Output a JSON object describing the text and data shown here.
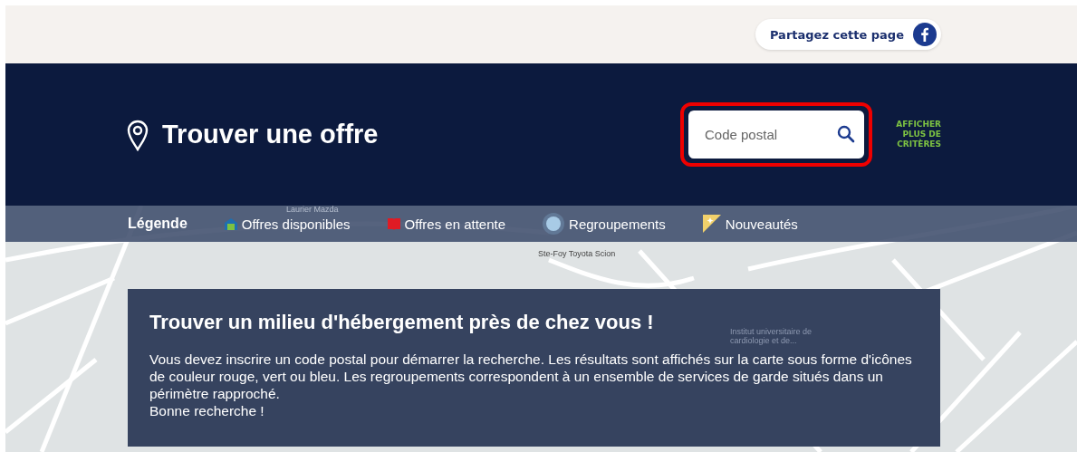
{
  "share": {
    "label": "Partagez cette page"
  },
  "header": {
    "title": "Trouver une offre",
    "search": {
      "placeholder": "Code postal",
      "highlighted": true
    },
    "more_criteria": "AFFICHER PLUS DE CRITÈRES"
  },
  "legend": {
    "title": "Légende",
    "items": [
      {
        "kind": "available",
        "label": "Offres disponibles"
      },
      {
        "kind": "waiting",
        "label": "Offres en attente"
      },
      {
        "kind": "cluster",
        "label": "Regroupements"
      },
      {
        "kind": "new",
        "label": "Nouveautés"
      }
    ]
  },
  "map_labels": [
    "Laurier Mazda",
    "Ste-Foy Toyota Scion",
    "Institut universitaire de cardiologie et de..."
  ],
  "info": {
    "title": "Trouver un milieu d'hébergement près de chez vous !",
    "text": "Vous devez inscrire un code postal pour démarrer la recherche. Les résultats sont affichés sur la carte sous forme d'icônes de couleur rouge, vert ou bleu. Les regroupements correspondent à un ensemble de services de garde situés dans un périmètre rapproché.",
    "closing": "Bonne recherche !"
  }
}
